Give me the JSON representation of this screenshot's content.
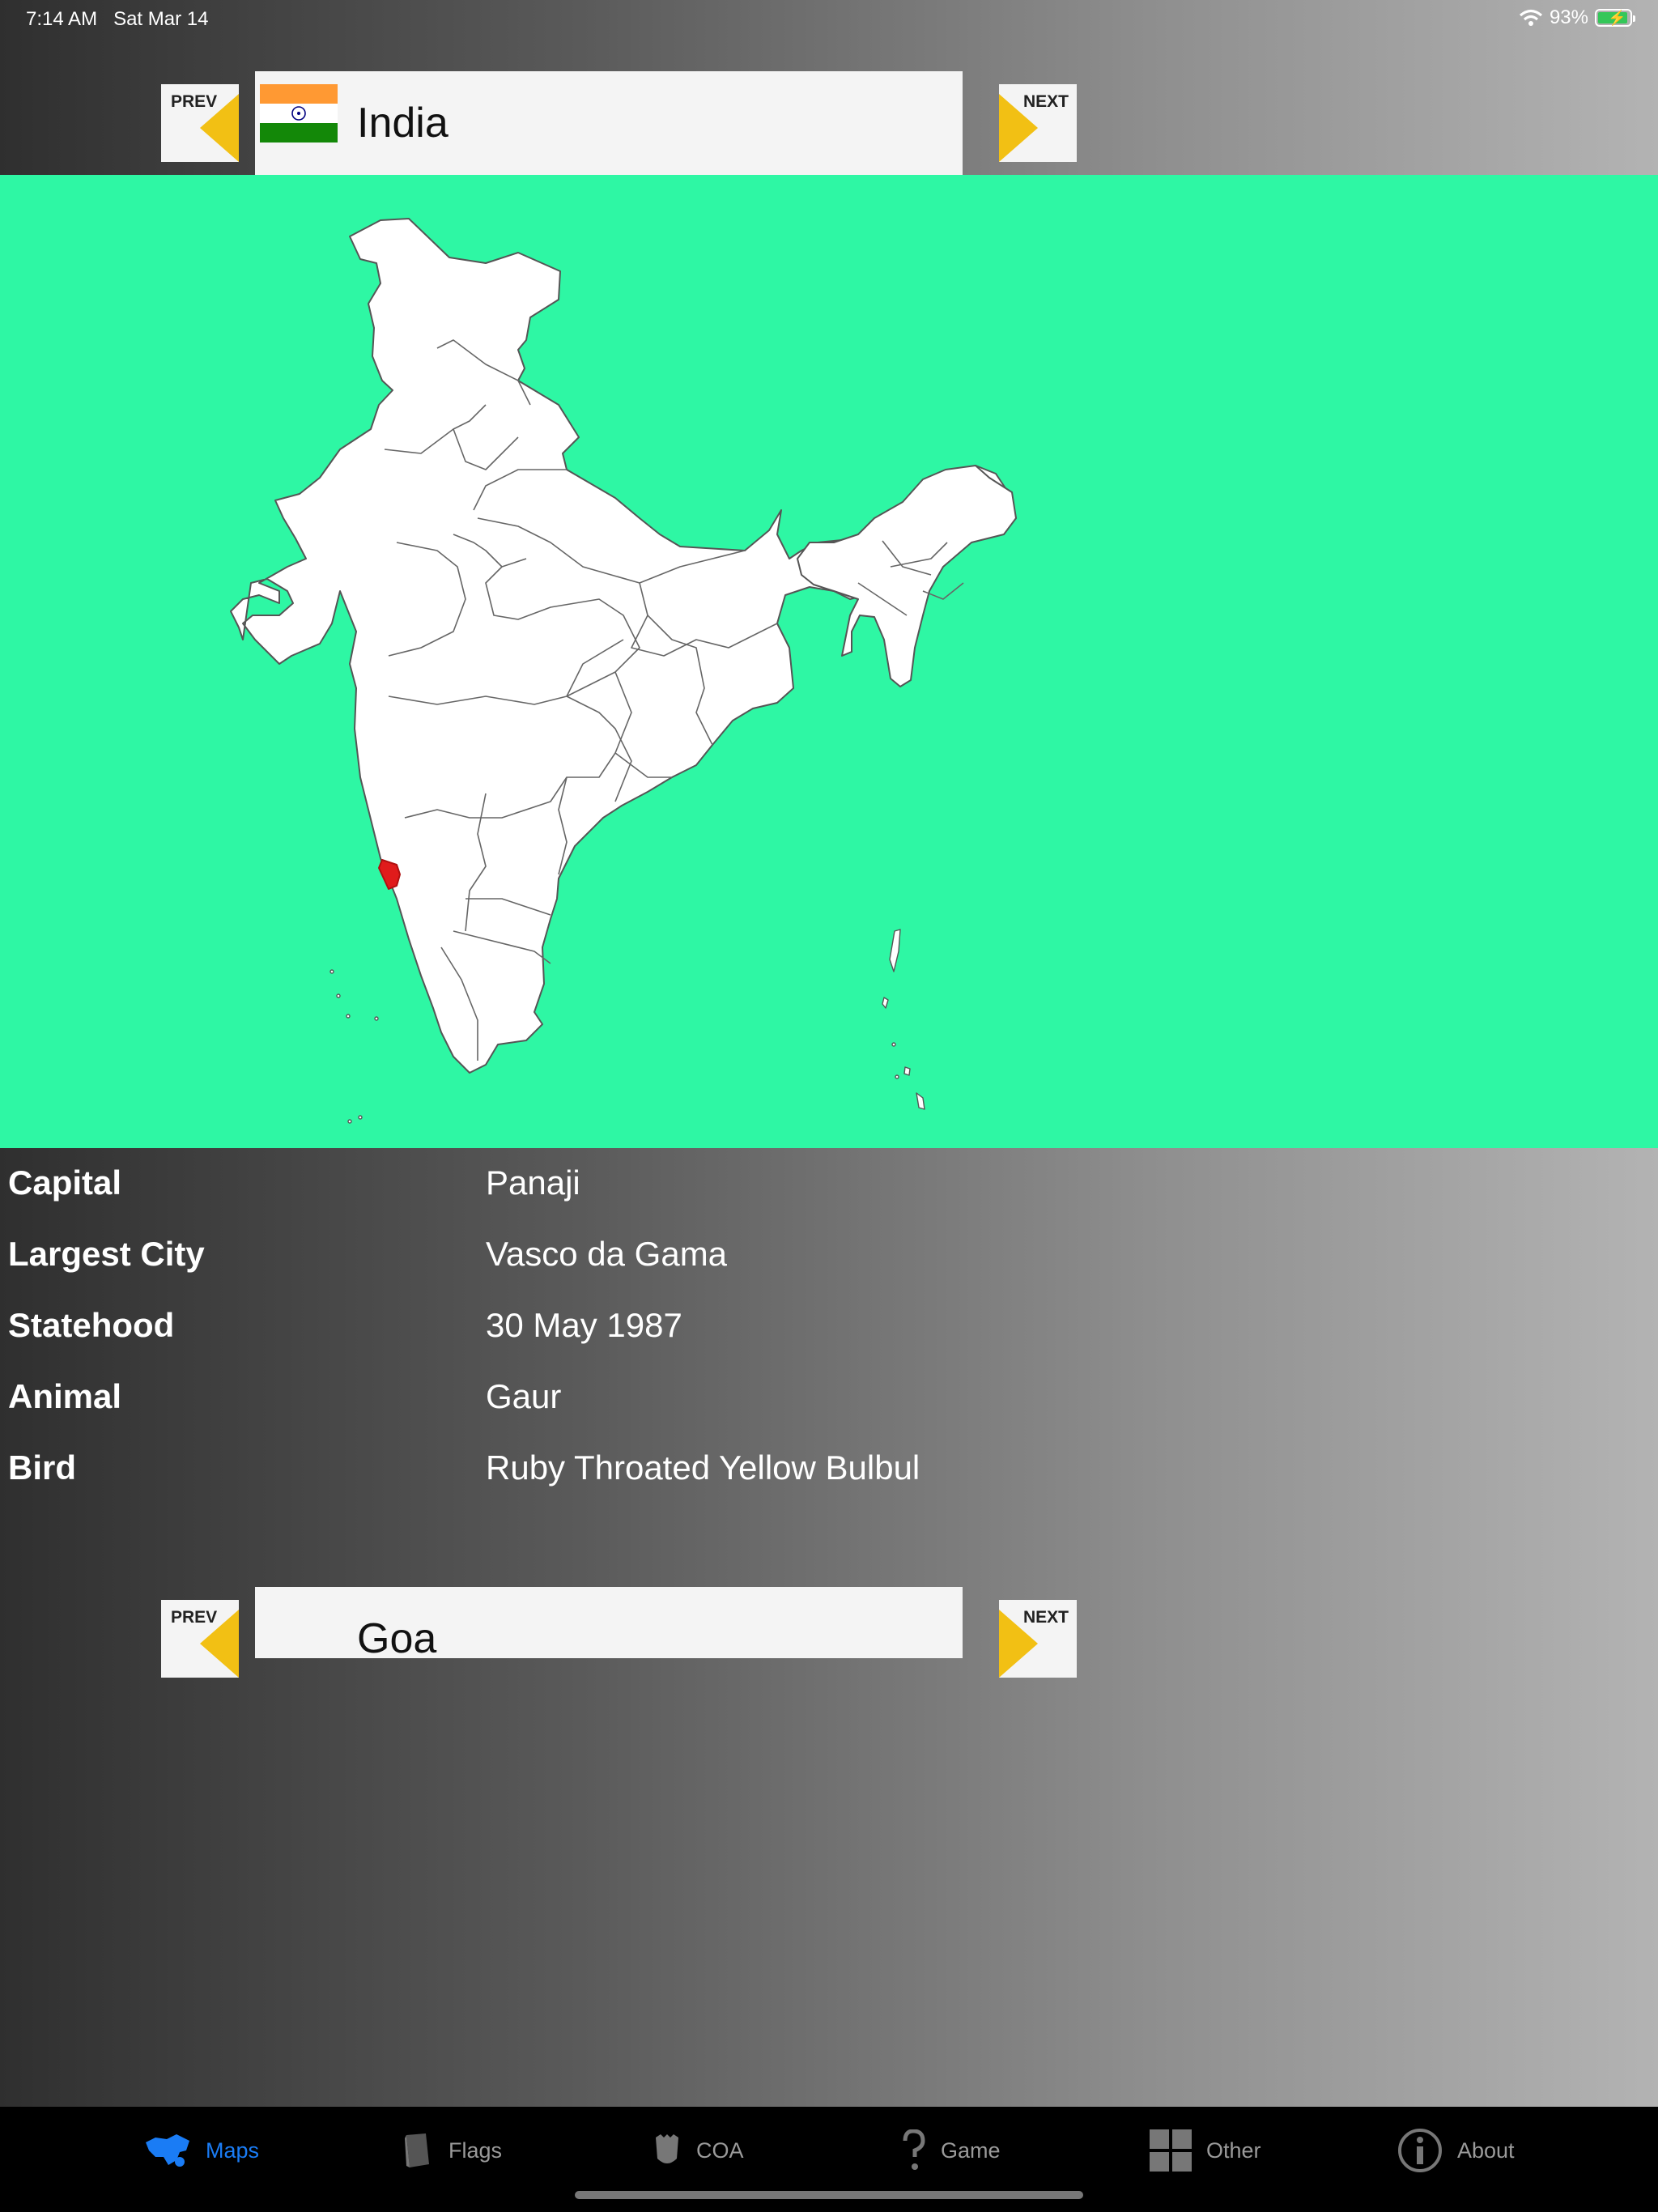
{
  "status_bar": {
    "time": "7:14 AM",
    "date": "Sat Mar 14",
    "battery": "93%",
    "wifi_icon": "wifi-icon",
    "battery_level": 0.93
  },
  "country_nav": {
    "prev_label": "PREV",
    "next_label": "NEXT",
    "country_name": "India",
    "flag_colors": {
      "saffron": "#ff9933",
      "white": "#ffffff",
      "green": "#138808",
      "chakra": "#000080"
    }
  },
  "map": {
    "background": "#2ef7a4",
    "highlight_color": "#e01b1b",
    "highlighted_region": "Goa"
  },
  "info_rows": [
    {
      "label": "Capital",
      "value": "Panaji"
    },
    {
      "label": "Largest City",
      "value": "Vasco da Gama"
    },
    {
      "label": "Statehood",
      "value": "30 May 1987"
    },
    {
      "label": "Animal",
      "value": "Gaur"
    },
    {
      "label": "Bird",
      "value": "Ruby Throated Yellow Bulbul"
    }
  ],
  "state_nav": {
    "prev_label": "PREV",
    "next_label": "NEXT",
    "state_name": "Goa"
  },
  "tabs": [
    {
      "label": "Maps",
      "icon": "globe-map-icon",
      "active": true
    },
    {
      "label": "Flags",
      "icon": "flag-book-icon",
      "active": false
    },
    {
      "label": "COA",
      "icon": "shield-icon",
      "active": false
    },
    {
      "label": "Game",
      "icon": "question-icon",
      "active": false
    },
    {
      "label": "Other",
      "icon": "grid-icon",
      "active": false
    },
    {
      "label": "About",
      "icon": "info-icon",
      "active": false
    }
  ],
  "colors": {
    "accent": "#1a7cf5",
    "nav_arrow": "#f2c014",
    "tab_inactive": "#9a9a9a"
  }
}
